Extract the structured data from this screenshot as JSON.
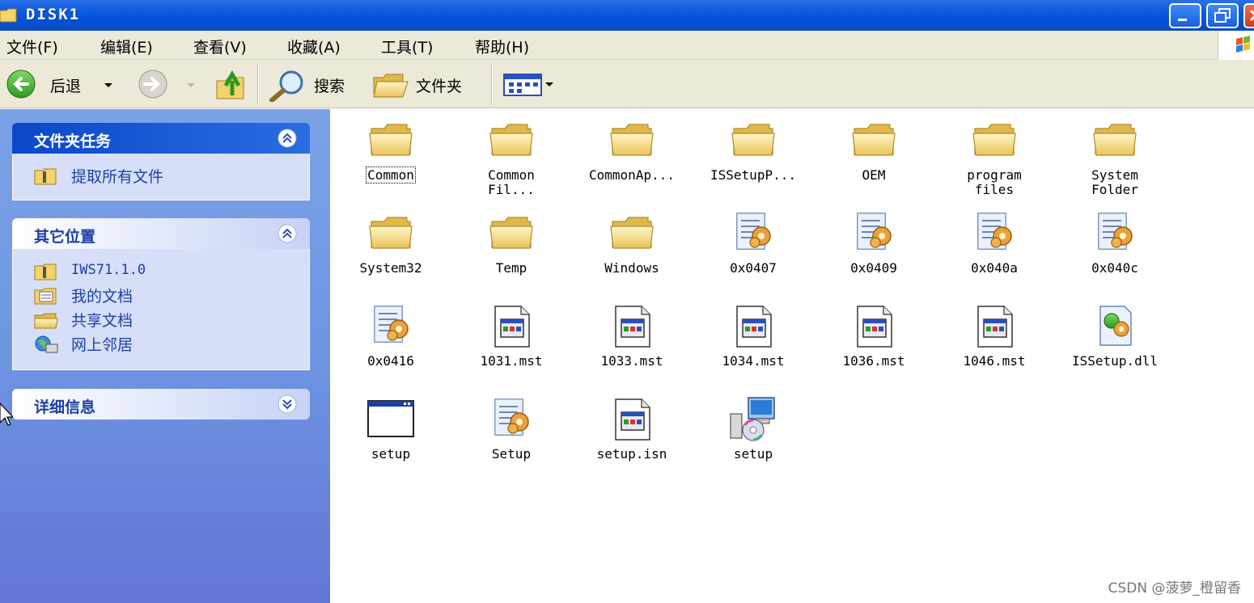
{
  "window": {
    "title": "DISK1",
    "colors": {
      "titlebar": "#0a58e0",
      "taskpane": "#6e95e2",
      "link": "#1c3fa8"
    }
  },
  "menu": [
    {
      "label": "文件(F)"
    },
    {
      "label": "编辑(E)"
    },
    {
      "label": "查看(V)"
    },
    {
      "label": "收藏(A)"
    },
    {
      "label": "工具(T)"
    },
    {
      "label": "帮助(H)"
    }
  ],
  "toolbar": {
    "back_label": "后退",
    "search_label": "搜索",
    "folders_label": "文件夹"
  },
  "taskpane": {
    "folder_tasks": {
      "title": "文件夹任务",
      "items": [
        {
          "label": "提取所有文件",
          "icon": "extract-icon"
        }
      ]
    },
    "other_places": {
      "title": "其它位置",
      "items": [
        {
          "label": "IWS71.1.0",
          "icon": "folder-zip-icon"
        },
        {
          "label": "我的文档",
          "icon": "my-documents-icon"
        },
        {
          "label": "共享文档",
          "icon": "shared-folder-icon"
        },
        {
          "label": "网上邻居",
          "icon": "network-icon"
        }
      ]
    },
    "details": {
      "title": "详细信息"
    }
  },
  "files": [
    {
      "label": "Common",
      "icon": "folder-icon"
    },
    {
      "label": "Common\nFil...",
      "icon": "folder-icon"
    },
    {
      "label": "CommonAp...",
      "icon": "folder-icon"
    },
    {
      "label": "ISSetupP...",
      "icon": "folder-icon"
    },
    {
      "label": "OEM",
      "icon": "folder-icon"
    },
    {
      "label": "program\nfiles",
      "icon": "folder-icon"
    },
    {
      "label": "System\nFolder",
      "icon": "folder-icon"
    },
    {
      "label": "System32",
      "icon": "folder-icon"
    },
    {
      "label": "Temp",
      "icon": "folder-icon"
    },
    {
      "label": "Windows",
      "icon": "folder-icon"
    },
    {
      "label": "0x0407",
      "icon": "config-file-icon"
    },
    {
      "label": "0x0409",
      "icon": "config-file-icon"
    },
    {
      "label": "0x040a",
      "icon": "config-file-icon"
    },
    {
      "label": "0x040c",
      "icon": "config-file-icon"
    },
    {
      "label": "0x0416",
      "icon": "config-file-icon"
    },
    {
      "label": "1031.mst",
      "icon": "mst-file-icon"
    },
    {
      "label": "1033.mst",
      "icon": "mst-file-icon"
    },
    {
      "label": "1034.mst",
      "icon": "mst-file-icon"
    },
    {
      "label": "1036.mst",
      "icon": "mst-file-icon"
    },
    {
      "label": "1046.mst",
      "icon": "mst-file-icon"
    },
    {
      "label": "ISSetup.dll",
      "icon": "dll-file-icon"
    },
    {
      "label": "setup",
      "icon": "app-window-icon"
    },
    {
      "label": "Setup",
      "icon": "config-file-icon"
    },
    {
      "label": "setup.isn",
      "icon": "mst-file-icon"
    },
    {
      "label": "setup",
      "icon": "installer-icon"
    }
  ],
  "watermark": "CSDN @菠萝_橙留香"
}
